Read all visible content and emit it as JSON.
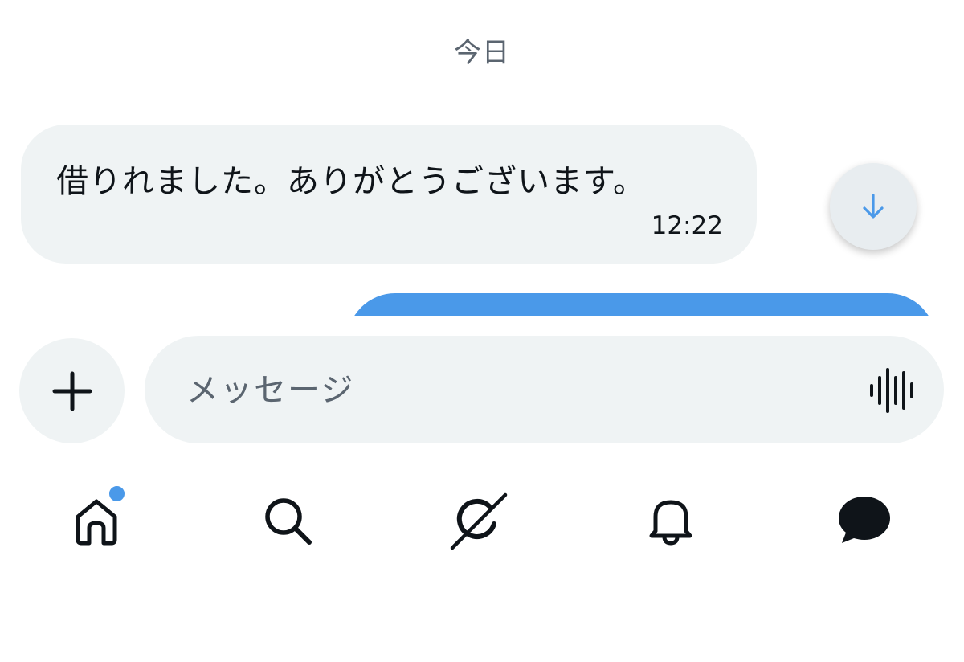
{
  "date_separator": "今日",
  "messages": [
    {
      "type": "received",
      "text": "借りれました。ありがとうございます。",
      "time": "12:22"
    }
  ],
  "composer": {
    "placeholder": "メッセージ",
    "add_icon": "plus-icon",
    "voice_icon": "audio-waveform-icon"
  },
  "scroll_button_icon": "arrow-down-icon",
  "tab_bar": {
    "items": [
      {
        "icon": "home-icon",
        "has_badge": true
      },
      {
        "icon": "search-icon",
        "has_badge": false
      },
      {
        "icon": "grok-icon",
        "has_badge": false
      },
      {
        "icon": "bell-icon",
        "has_badge": false
      },
      {
        "icon": "messages-icon",
        "has_badge": false,
        "active": true
      }
    ]
  },
  "colors": {
    "accent": "#4a99e9",
    "bubble_received": "#eff3f4",
    "text_primary": "#0f1419",
    "text_secondary": "#5b6570"
  }
}
